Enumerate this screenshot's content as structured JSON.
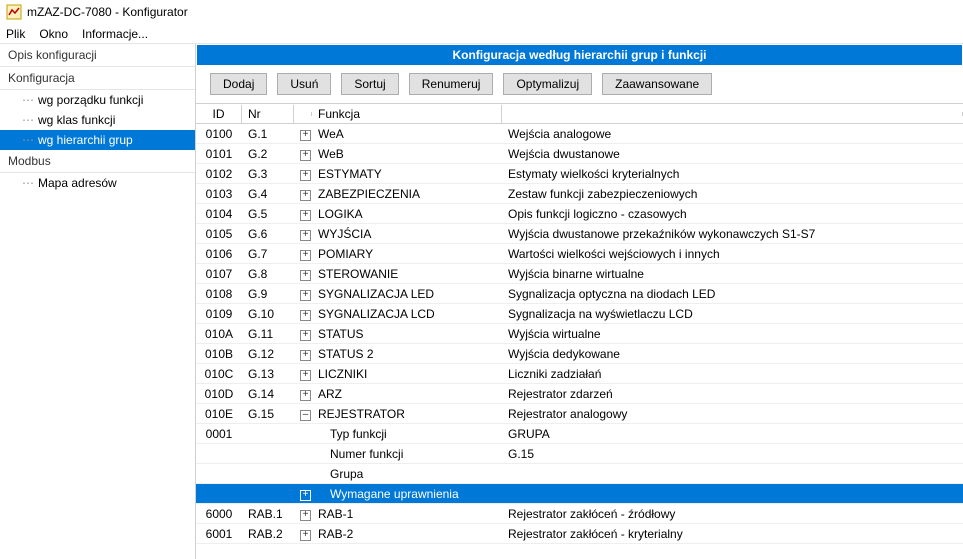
{
  "window": {
    "title": "mZAZ-DC-7080 - Konfigurator"
  },
  "menu": {
    "items": [
      "Plik",
      "Okno",
      "Informacje..."
    ]
  },
  "sidebar": {
    "groups": [
      {
        "title": "Opis konfiguracji",
        "items": []
      },
      {
        "title": "Konfiguracja",
        "items": [
          {
            "label": "wg porządku funkcji",
            "selected": false
          },
          {
            "label": "wg klas funkcji",
            "selected": false
          },
          {
            "label": "wg hierarchii grup",
            "selected": true
          }
        ]
      },
      {
        "title": "Modbus",
        "items": [
          {
            "label": "Mapa adresów",
            "selected": false
          }
        ]
      }
    ]
  },
  "content": {
    "header": "Konfiguracja według hierarchii grup i funkcji",
    "buttons": [
      "Dodaj",
      "Usuń",
      "Sortuj",
      "Renumeruj",
      "Optymalizuj",
      "Zaawansowane"
    ],
    "columns": {
      "id": "ID",
      "nr": "Nr",
      "func": "Funkcja"
    },
    "rows": [
      {
        "id": "0100",
        "nr": "G.1",
        "exp": "+",
        "func": "WeA",
        "desc": "Wejścia analogowe"
      },
      {
        "id": "0101",
        "nr": "G.2",
        "exp": "+",
        "func": "WeB",
        "desc": "Wejścia dwustanowe"
      },
      {
        "id": "0102",
        "nr": "G.3",
        "exp": "+",
        "func": "ESTYMATY",
        "desc": "Estymaty wielkości kryterialnych"
      },
      {
        "id": "0103",
        "nr": "G.4",
        "exp": "+",
        "func": "ZABEZPIECZENIA",
        "desc": "Zestaw funkcji zabezpieczeniowych"
      },
      {
        "id": "0104",
        "nr": "G.5",
        "exp": "+",
        "func": "LOGIKA",
        "desc": "Opis funkcji logiczno - czasowych"
      },
      {
        "id": "0105",
        "nr": "G.6",
        "exp": "+",
        "func": "WYJŚCIA",
        "desc": "Wyjścia dwustanowe przekaźników wykonawczych S1-S7"
      },
      {
        "id": "0106",
        "nr": "G.7",
        "exp": "+",
        "func": "POMIARY",
        "desc": "Wartości wielkości wejściowych i innych"
      },
      {
        "id": "0107",
        "nr": "G.8",
        "exp": "+",
        "func": "STEROWANIE",
        "desc": "Wyjścia binarne wirtualne"
      },
      {
        "id": "0108",
        "nr": "G.9",
        "exp": "+",
        "func": "SYGNALIZACJA LED",
        "desc": "Sygnalizacja optyczna na diodach LED"
      },
      {
        "id": "0109",
        "nr": "G.10",
        "exp": "+",
        "func": "SYGNALIZACJA LCD",
        "desc": "Sygnalizacja na wyświetlaczu LCD"
      },
      {
        "id": "010A",
        "nr": "G.11",
        "exp": "+",
        "func": "STATUS",
        "desc": "Wyjścia wirtualne"
      },
      {
        "id": "010B",
        "nr": "G.12",
        "exp": "+",
        "func": "STATUS 2",
        "desc": "Wyjścia dedykowane"
      },
      {
        "id": "010C",
        "nr": "G.13",
        "exp": "+",
        "func": "LICZNIKI",
        "desc": "Liczniki zadziałań"
      },
      {
        "id": "010D",
        "nr": "G.14",
        "exp": "+",
        "func": "ARZ",
        "desc": "Rejestrator zdarzeń"
      },
      {
        "id": "010E",
        "nr": "G.15",
        "exp": "–",
        "func": "REJESTRATOR",
        "desc": "Rejestrator analogowy"
      },
      {
        "id": "0001",
        "nr": "",
        "exp": "",
        "func": "Typ funkcji",
        "desc": "GRUPA",
        "child": true
      },
      {
        "id": "",
        "nr": "",
        "exp": "",
        "func": "Numer funkcji",
        "desc": "G.15",
        "child": true
      },
      {
        "id": "",
        "nr": "",
        "exp": "",
        "func": "Grupa",
        "desc": "",
        "child": true
      },
      {
        "id": "",
        "nr": "",
        "exp": "+",
        "func": "Wymagane uprawnienia",
        "desc": "",
        "child": true,
        "selected": true
      },
      {
        "id": "6000",
        "nr": "RAB.1",
        "exp": "+",
        "func": "RAB-1",
        "desc": "Rejestrator zakłóceń - źródłowy"
      },
      {
        "id": "6001",
        "nr": "RAB.2",
        "exp": "+",
        "func": "RAB-2",
        "desc": "Rejestrator zakłóceń - kryterialny"
      }
    ]
  }
}
